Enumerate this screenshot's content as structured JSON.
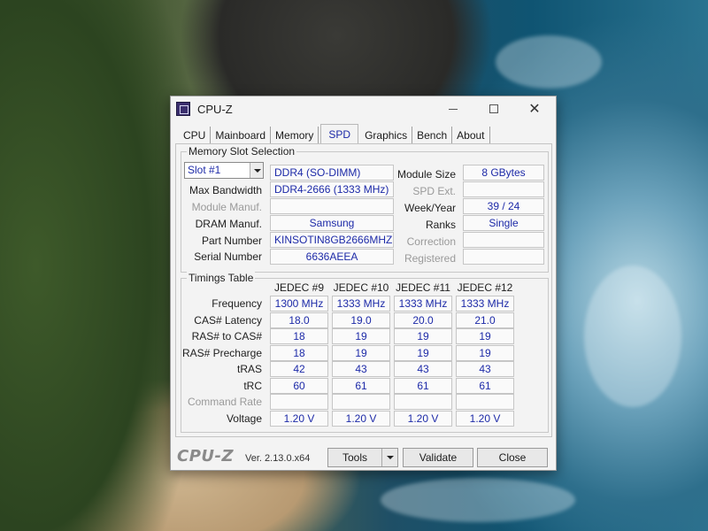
{
  "window": {
    "title": "CPU-Z",
    "tabs": [
      "CPU",
      "Mainboard",
      "Memory",
      "SPD",
      "Graphics",
      "Bench",
      "About"
    ],
    "active_tab": "SPD"
  },
  "slot": {
    "group_title": "Memory Slot Selection",
    "selected": "Slot #1",
    "type": "DDR4 (SO-DIMM)",
    "max_bandwidth_label": "Max Bandwidth",
    "max_bandwidth": "DDR4-2666 (1333 MHz)",
    "module_manuf_label": "Module Manuf.",
    "module_manuf": "",
    "dram_manuf_label": "DRAM Manuf.",
    "dram_manuf": "Samsung",
    "part_number_label": "Part Number",
    "part_number": "KINSOTIN8GB2666MHZ",
    "serial_number_label": "Serial Number",
    "serial_number": "6636AEEA",
    "module_size_label": "Module Size",
    "module_size": "8 GBytes",
    "spd_ext_label": "SPD Ext.",
    "spd_ext": "",
    "week_year_label": "Week/Year",
    "week_year": "39 / 24",
    "ranks_label": "Ranks",
    "ranks": "Single",
    "correction_label": "Correction",
    "correction": "",
    "registered_label": "Registered",
    "registered": ""
  },
  "timings": {
    "group_title": "Timings Table",
    "columns": [
      "JEDEC #9",
      "JEDEC #10",
      "JEDEC #11",
      "JEDEC #12"
    ],
    "rows": [
      {
        "label": "Frequency",
        "dim": false,
        "values": [
          "1300 MHz",
          "1333 MHz",
          "1333 MHz",
          "1333 MHz"
        ]
      },
      {
        "label": "CAS# Latency",
        "dim": false,
        "values": [
          "18.0",
          "19.0",
          "20.0",
          "21.0"
        ]
      },
      {
        "label": "RAS# to CAS#",
        "dim": false,
        "values": [
          "18",
          "19",
          "19",
          "19"
        ]
      },
      {
        "label": "RAS# Precharge",
        "dim": false,
        "values": [
          "18",
          "19",
          "19",
          "19"
        ]
      },
      {
        "label": "tRAS",
        "dim": false,
        "values": [
          "42",
          "43",
          "43",
          "43"
        ]
      },
      {
        "label": "tRC",
        "dim": false,
        "values": [
          "60",
          "61",
          "61",
          "61"
        ]
      },
      {
        "label": "Command Rate",
        "dim": true,
        "values": [
          "",
          "",
          "",
          ""
        ]
      },
      {
        "label": "Voltage",
        "dim": false,
        "values": [
          "1.20 V",
          "1.20 V",
          "1.20 V",
          "1.20 V"
        ]
      }
    ]
  },
  "footer": {
    "logo": "CPU-Z",
    "version": "Ver. 2.13.0.x64",
    "tools_label": "Tools",
    "validate_label": "Validate",
    "close_label": "Close"
  }
}
